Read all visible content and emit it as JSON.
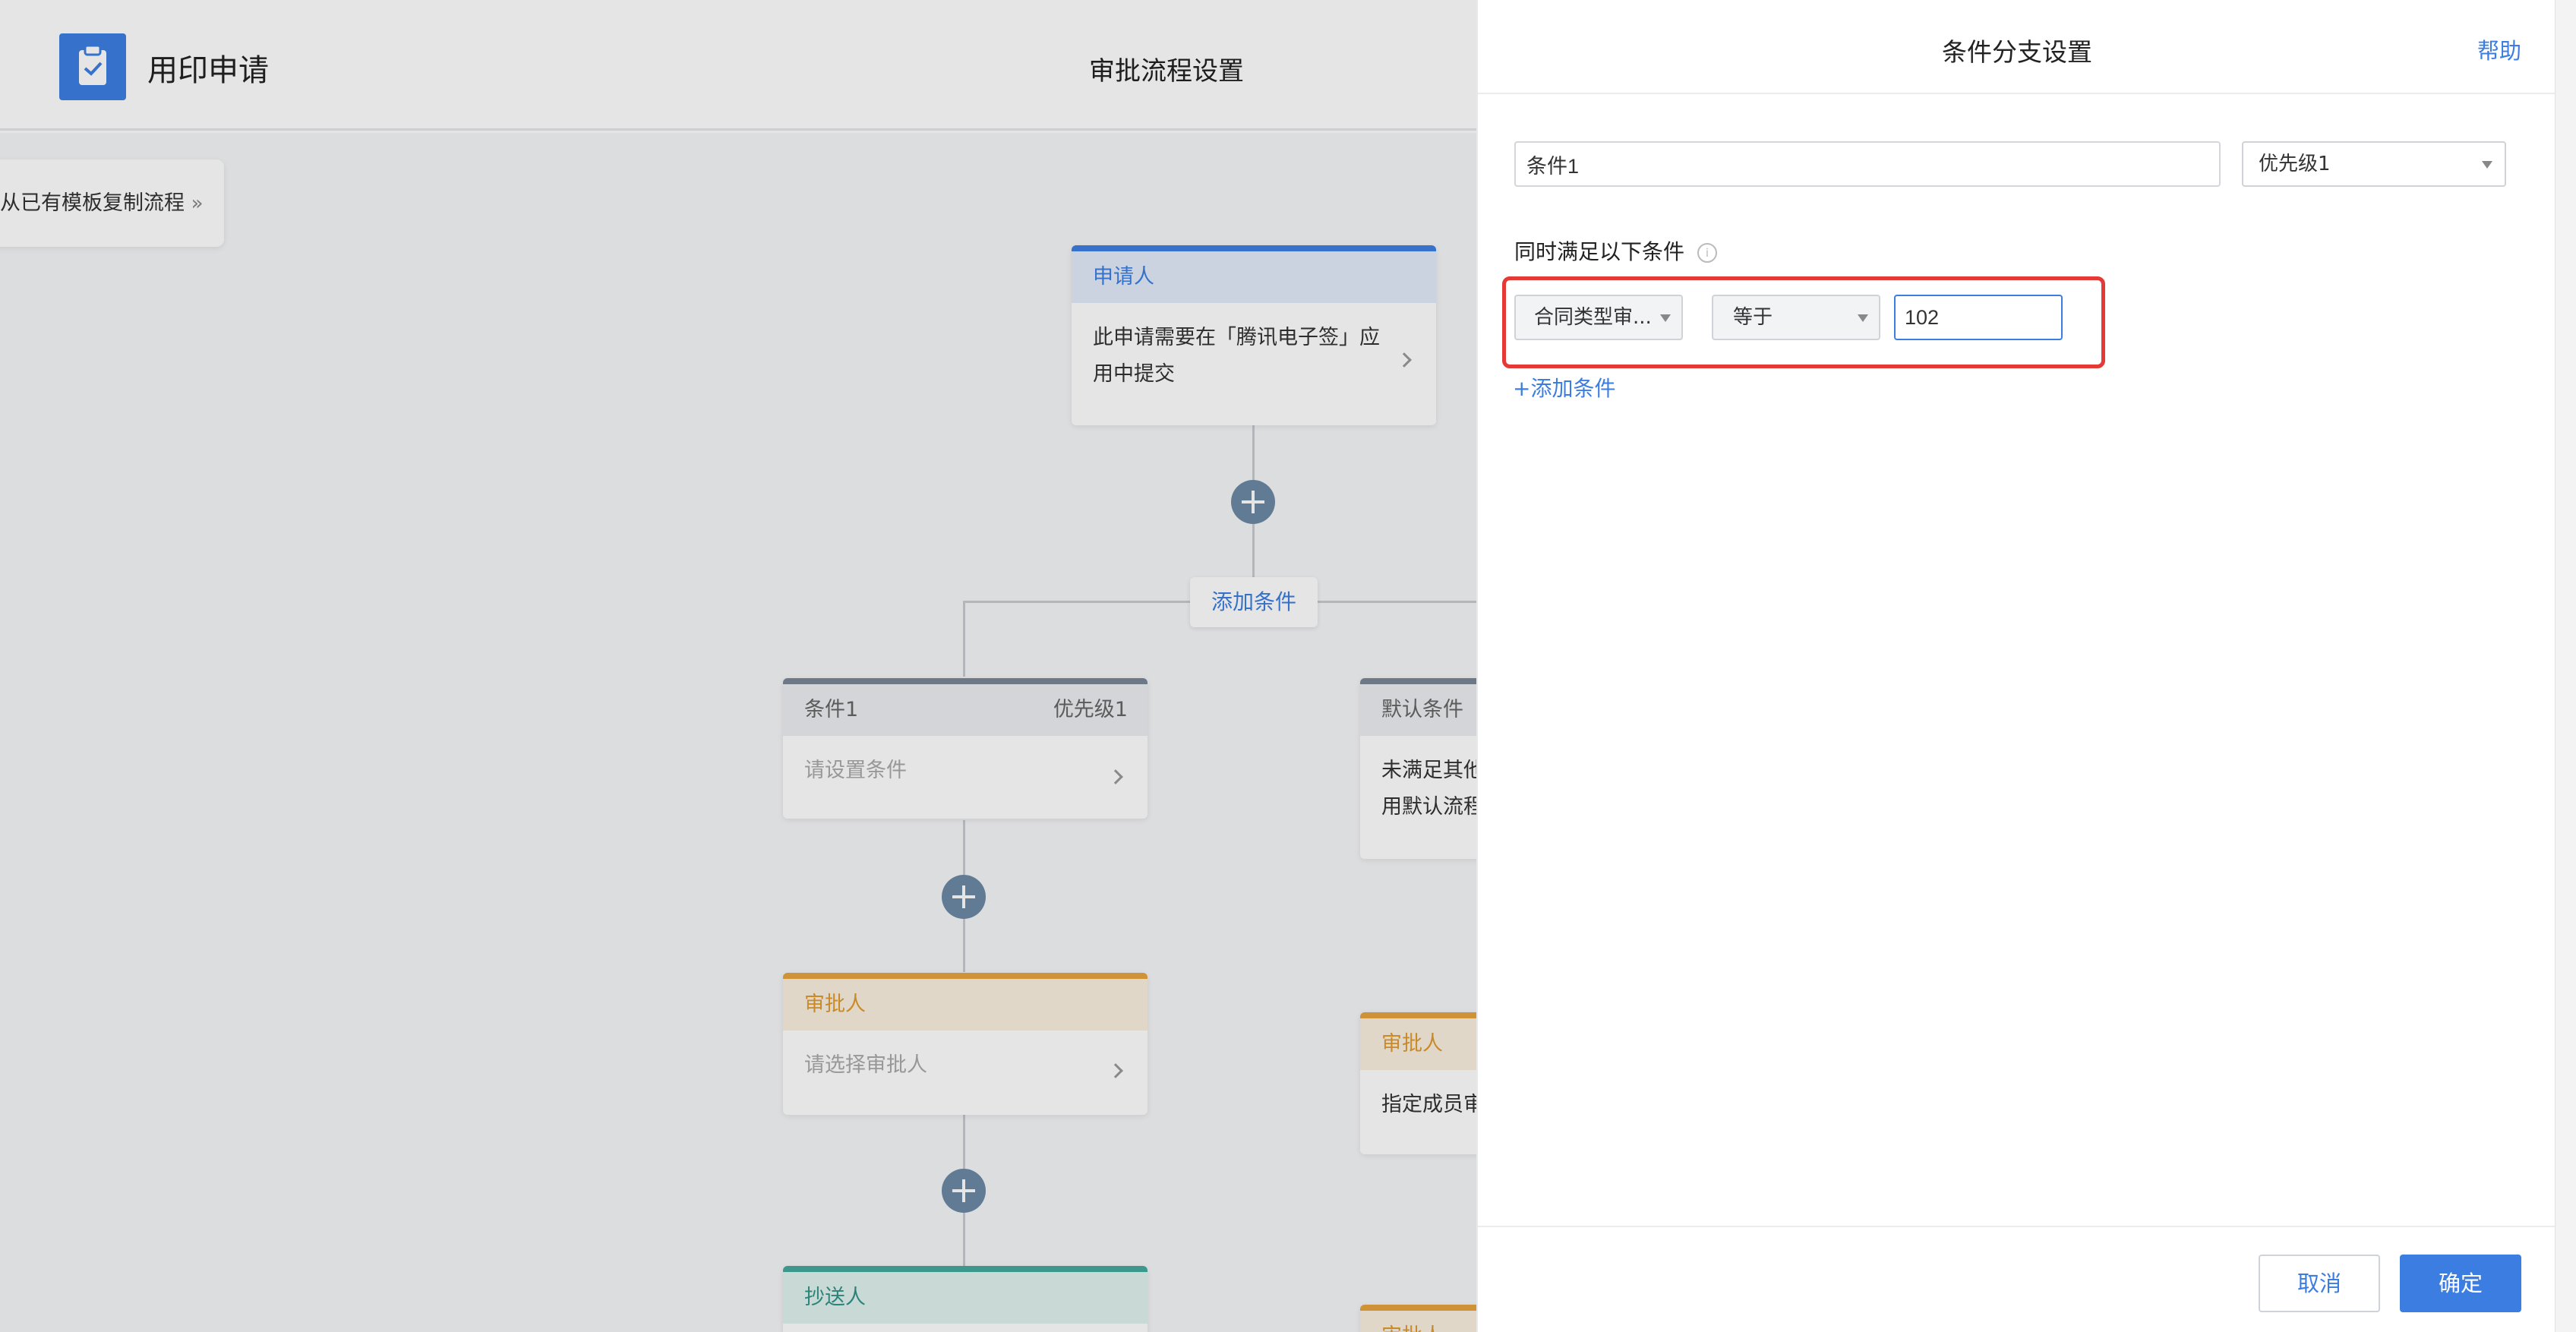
{
  "app": {
    "name": "用印申请",
    "icon": "clipboard-check-icon",
    "page_title": "审批流程设置"
  },
  "canvas": {
    "copy_template": {
      "label": "从已有模板复制流程",
      "icon": "double-chevron-right-icon"
    },
    "applicant": {
      "title": "申请人",
      "body": "此申请需要在「腾讯电子签」应用中提交",
      "accent": "#3d7ee3"
    },
    "add_condition_label": "添加条件",
    "condition1": {
      "title": "条件1",
      "priority": "优先级1",
      "placeholder": "请设置条件"
    },
    "default_condition": {
      "title": "默认条件",
      "body_lines": [
        "未满足其他",
        "用默认流程"
      ]
    },
    "approver": {
      "title": "审批人",
      "placeholder": "请选择审批人",
      "accent": "#e8a33d"
    },
    "approver_right": {
      "title": "审批人",
      "body": "指定成员审",
      "accent": "#e8a33d"
    },
    "cc": {
      "title": "抄送人",
      "accent": "#43a99c"
    },
    "approver_bottom": {
      "title": "审批人"
    }
  },
  "panel": {
    "title": "条件分支设置",
    "help": "帮助",
    "condition_name": "条件1",
    "priority_select": "优先级1",
    "section_label": "同时满足以下条件",
    "rule": {
      "field": "合同类型审...",
      "operator": "等于",
      "value": "102"
    },
    "add_condition": "+添加条件",
    "cancel": "取消",
    "confirm": "确定",
    "highlight_color": "#e53935",
    "primary_color": "#3b7de0"
  }
}
